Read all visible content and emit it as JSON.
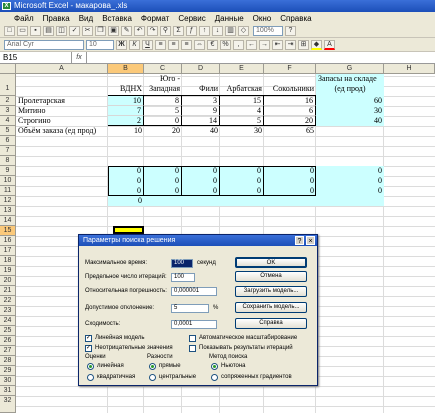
{
  "window": {
    "title": "Microsoft Excel - макарова_.xls",
    "app_icon": "X"
  },
  "menu": [
    "Файл",
    "Правка",
    "Вид",
    "Вставка",
    "Формат",
    "Сервис",
    "Данные",
    "Окно",
    "Справка"
  ],
  "toolbar": {
    "zoom": "100%",
    "font": "Arial Cyr",
    "size": "10"
  },
  "formula_bar": {
    "name_box": "B15",
    "fx": "fx"
  },
  "columns": [
    "A",
    "B",
    "C",
    "D",
    "E",
    "F",
    "G",
    "H"
  ],
  "rows": [
    "1",
    "2",
    "3",
    "4",
    "5",
    "6",
    "7",
    "8",
    "9",
    "10",
    "11",
    "12",
    "13",
    "14",
    "15",
    "16",
    "17",
    "18",
    "19",
    "20",
    "21",
    "22",
    "23",
    "24",
    "25",
    "26",
    "27",
    "28",
    "29",
    "30",
    "31",
    "32"
  ],
  "headers": {
    "B1": "ВДНХ",
    "C1a": "Юго -",
    "C1b": "Западная",
    "D1": "Фили",
    "E1": "Арбатская",
    "F1": "Сокольники",
    "G1a": "Запасы на складе",
    "G1b": "(ед прод)"
  },
  "table": [
    {
      "name": "Пролетарская",
      "vals": [
        "10",
        "8",
        "3",
        "15",
        "16"
      ],
      "stock": "60"
    },
    {
      "name": "Митино",
      "vals": [
        "7",
        "5",
        "9",
        "4",
        "6"
      ],
      "stock": "30"
    },
    {
      "name": "Строгино",
      "vals": [
        "2",
        "0",
        "14",
        "5",
        "20"
      ],
      "stock": "40"
    },
    {
      "name": "Объём заказа (ед прод)",
      "vals": [
        "10",
        "20",
        "40",
        "30",
        "65"
      ],
      "stock": ""
    }
  ],
  "zeros": {
    "r9": [
      "0",
      "0",
      "0",
      "0",
      "0",
      "0"
    ],
    "r10": [
      "0",
      "0",
      "0",
      "0",
      "0",
      "0"
    ],
    "r11": [
      "0",
      "0",
      "0",
      "0",
      "0",
      "0"
    ],
    "r12": "0"
  },
  "dialog": {
    "title": "Параметры поиска решения",
    "help_btn": "?",
    "close_btn": "×",
    "max_time_label": "Максимальное время:",
    "max_time": "100",
    "seconds": "секунд",
    "max_iter_label": "Предельное число итераций:",
    "max_iter": "100",
    "precision_label": "Относительная погрешность:",
    "precision": "0,000001",
    "tolerance_label": "Допустимое отклонение:",
    "tolerance": "5",
    "percent": "%",
    "convergence_label": "Сходимость:",
    "convergence": "0,0001",
    "ok": "OK",
    "cancel": "Отмена",
    "load": "Загрузить модель...",
    "save": "Сохранить модель...",
    "help": "Справка",
    "linear_model": "Линейная модель",
    "auto_scale": "Автоматическое масштабирование",
    "nonneg": "Неотрицательные значения",
    "show_iter": "Показывать результаты итераций",
    "estimates": "Оценки",
    "linear": "линейная",
    "quadratic": "квадратичная",
    "derivatives": "Разности",
    "forward": "прямые",
    "central": "центральные",
    "method": "Метод поиска",
    "newton": "Ньютона",
    "conjugate": "сопряженных градиентов"
  }
}
